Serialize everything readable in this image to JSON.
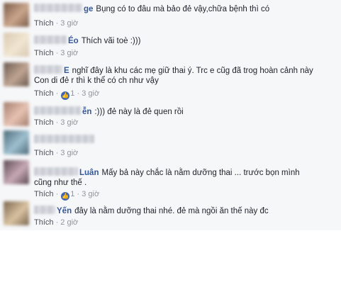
{
  "comments": [
    {
      "name": "ge",
      "text": "Bụng có to đâu mà bảo đẻ vậy,chữa bệnh thì có",
      "like_label": "Thích",
      "time": "3 giờ",
      "avatar_colors": [
        "#7b5c4a",
        "#c9a58c"
      ]
    },
    {
      "name": "Éo",
      "text": "Thích vãi toè :)))",
      "like_label": "Thích",
      "time": "3 giờ",
      "avatar_colors": [
        "#d9c8b0",
        "#f0e6d2"
      ]
    },
    {
      "name": "E",
      "text_line1": "nghĩ đây là khu các mẹ giữ thai ý. Trc e cũg đã trog hoàn cảnh này",
      "text_line2": "Con di đẻ r thì k thể có ch như vậy",
      "like_label": "Thích",
      "like_count": "1",
      "time": "3 giờ",
      "avatar_colors": [
        "#6b5a4f",
        "#bfa492"
      ]
    },
    {
      "name": "ễn",
      "text": ":))) đẻ này là đẻ quen rồi",
      "like_label": "Thích",
      "time": "3 giờ",
      "avatar_colors": [
        "#a47d6e",
        "#e6c2b2"
      ]
    },
    {
      "name": "",
      "text": "",
      "like_label": "Thích",
      "time": "3 giờ",
      "avatar_colors": [
        "#4e6b7a",
        "#9fc0cf"
      ]
    },
    {
      "name": "Luân",
      "text_line1": "Mấy bả này chắc là nằm dưỡng thai ... trước bọn mình",
      "text_line2": "cũng như thế .",
      "like_label": "Thích",
      "like_count": "1",
      "time": "3 giờ",
      "avatar_colors": [
        "#5c4a52",
        "#c7a9b5"
      ]
    },
    {
      "name": "Yến",
      "text": "đây là nằm dưỡng thai nhé. đẻ mà ngồi ăn thế này đc",
      "like_label": "Thích",
      "time": "2 giờ",
      "avatar_colors": [
        "#7a6650",
        "#d9c2a0"
      ]
    }
  ],
  "colors": {
    "link": "#365899",
    "meta": "#90949c",
    "like_badge": "#4267b2",
    "background": "#f6f7f9"
  }
}
